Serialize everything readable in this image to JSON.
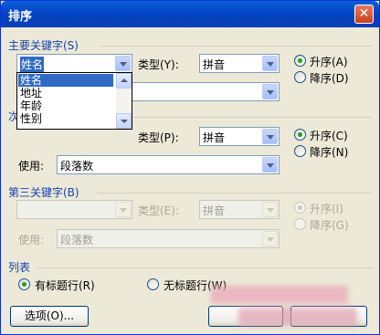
{
  "window": {
    "title": "排序",
    "close_icon": "close-icon"
  },
  "primary": {
    "heading": "主要关键字(S)",
    "field_value": "姓名",
    "type_label": "类型(Y):",
    "type_value": "拼音",
    "use_value": "",
    "asc_label": "升序(A)",
    "desc_label": "降序(D)",
    "order": "ascending",
    "dropdown_options": [
      "姓名",
      "地址",
      "年龄",
      "性别"
    ],
    "dropdown_selected": "姓名"
  },
  "secondary": {
    "heading_fragment": "次",
    "type_label": "类型(P):",
    "type_value": "拼音",
    "use_label": "使用:",
    "use_value": "段落数",
    "asc_label": "升序(C)",
    "desc_label": "降序(N)",
    "order": "ascending"
  },
  "tertiary": {
    "heading": "第三关键字(B)",
    "field_value": "",
    "type_label": "类型(E):",
    "type_value": "拼音",
    "use_label": "使用:",
    "use_value": "段落数",
    "asc_label": "升序(I)",
    "desc_label": "降序(G)",
    "order": "ascending"
  },
  "list": {
    "heading": "列表",
    "has_header_label": "有标题行(R)",
    "no_header_label": "无标题行(W)",
    "selected": "has_header"
  },
  "buttons": {
    "options_label": "选项(O)...",
    "ok_label": "",
    "cancel_label": ""
  },
  "colors": {
    "title_bar": "#0a5fd8",
    "accent": "#316ac5",
    "section_label": "#1a3fa8"
  }
}
